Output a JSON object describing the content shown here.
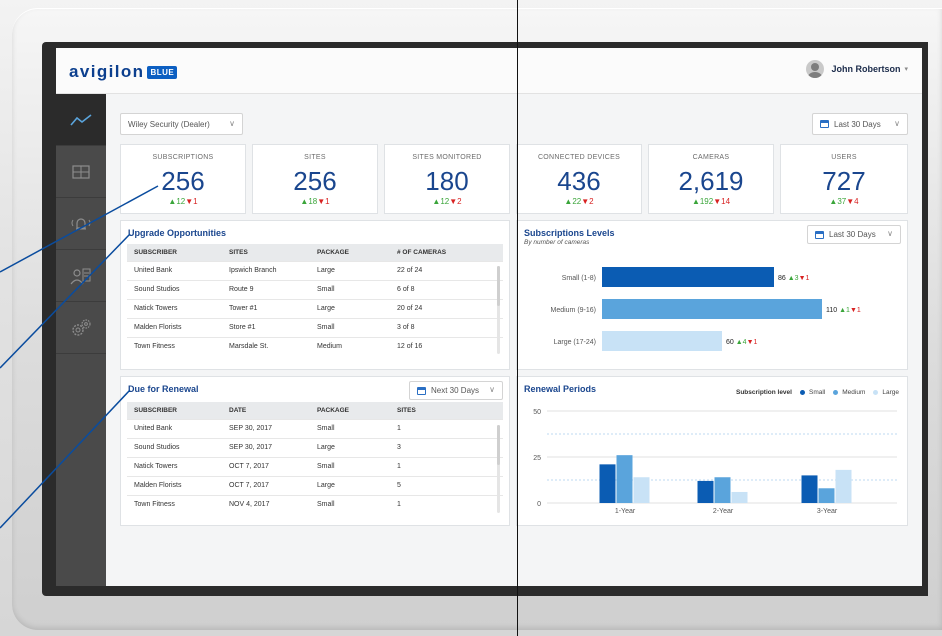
{
  "app": {
    "logo_text": "avigilon",
    "logo_badge": "BLUE"
  },
  "user": {
    "name": "John Robertson",
    "caret": "▾"
  },
  "filters": {
    "dealer": "Wiley Security (Dealer)",
    "range": "Last 30 Days",
    "renewal_range": "Next 30 Days",
    "levels_range": "Last 30 Days"
  },
  "stats": [
    {
      "label": "SUBSCRIPTIONS",
      "value": "256",
      "up": "12",
      "down": "1"
    },
    {
      "label": "SITES",
      "value": "256",
      "up": "18",
      "down": "1"
    },
    {
      "label": "SITES MONITORED",
      "value": "180",
      "up": "12",
      "down": "2"
    },
    {
      "label": "CONNECTED DEVICES",
      "value": "436",
      "up": "22",
      "down": "2"
    },
    {
      "label": "CAMERAS",
      "value": "2,619",
      "up": "192",
      "down": "14"
    },
    {
      "label": "USERS",
      "value": "727",
      "up": "37",
      "down": "4"
    }
  ],
  "upgrade": {
    "title": "Upgrade Opportunities",
    "headers": [
      "SUBSCRIBER",
      "SITES",
      "PACKAGE",
      "# OF CAMERAS"
    ],
    "rows": [
      [
        "United Bank",
        "Ipswich Branch",
        "Large",
        "22 of 24"
      ],
      [
        "Sound Studios",
        "Route 9",
        "Small",
        "6 of 8"
      ],
      [
        "Natick Towers",
        "Tower #1",
        "Large",
        "20 of 24"
      ],
      [
        "Malden Florists",
        "Store #1",
        "Small",
        "3 of 8"
      ],
      [
        "Town Fitness",
        "Marsdale St.",
        "Medium",
        "12 of 16"
      ]
    ]
  },
  "renewal": {
    "title": "Due for Renewal",
    "headers": [
      "SUBSCRIBER",
      "DATE",
      "PACKAGE",
      "SITES"
    ],
    "rows": [
      [
        "United Bank",
        "SEP 30, 2017",
        "Small",
        "1"
      ],
      [
        "Sound Studios",
        "SEP 30, 2017",
        "Large",
        "3"
      ],
      [
        "Natick Towers",
        "OCT 7, 2017",
        "Small",
        "1"
      ],
      [
        "Malden Florists",
        "OCT 7, 2017",
        "Large",
        "5"
      ],
      [
        "Town Fitness",
        "NOV 4, 2017",
        "Small",
        "1"
      ]
    ]
  },
  "levels": {
    "title": "Subscriptions Levels",
    "subtitle": "By number of cameras"
  },
  "renewal_periods": {
    "title": "Renewal Periods",
    "legend_title": "Subscription level"
  },
  "colors": {
    "small": "#0b5cb3",
    "medium": "#5aa4dc",
    "large": "#c8e2f6",
    "accent": "#1a468e"
  },
  "chart_data": [
    {
      "type": "bar",
      "orientation": "horizontal",
      "title": "Subscriptions Levels",
      "subtitle": "By number of cameras",
      "categories": [
        "Small (1-8)",
        "Medium (9-16)",
        "Large (17-24)"
      ],
      "values": [
        86,
        110,
        60
      ],
      "up": [
        3,
        1,
        4
      ],
      "down": [
        1,
        1,
        1
      ]
    },
    {
      "type": "bar",
      "title": "Renewal Periods",
      "categories": [
        "1-Year",
        "2-Year",
        "3-Year"
      ],
      "ylim": [
        0,
        50
      ],
      "yticks": [
        0,
        25,
        50
      ],
      "legend": "top-right",
      "series": [
        {
          "name": "Small",
          "values": [
            21,
            12,
            15
          ]
        },
        {
          "name": "Medium",
          "values": [
            26,
            14,
            8
          ]
        },
        {
          "name": "Large",
          "values": [
            14,
            6,
            18
          ]
        }
      ]
    }
  ]
}
